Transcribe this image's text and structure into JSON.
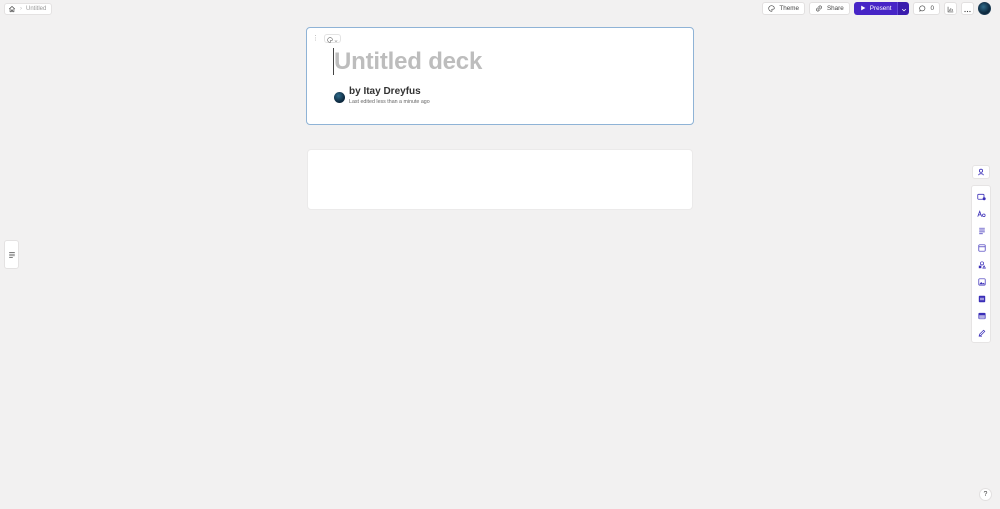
{
  "breadcrumb": {
    "doc_title": "Untitled"
  },
  "toolbar": {
    "theme_label": "Theme",
    "share_label": "Share",
    "present_label": "Present",
    "comments_count": "0"
  },
  "deck": {
    "title_placeholder": "Untitled deck",
    "author_line": "by Itay Dreyfus",
    "edited_line": "Last edited less than a minute ago"
  },
  "help": {
    "label": "?"
  },
  "colors": {
    "present_bg": "#4725c6",
    "selected_card_border": "#8fb3d6",
    "rail_icon": "#3b2fb8"
  },
  "icons": {
    "home": "home-icon",
    "theme": "palette-icon",
    "share": "share-link-icon",
    "present": "play-icon",
    "comment": "comment-icon",
    "analytics": "chart-icon",
    "more": "more-horizontal-icon",
    "card_outline": "outline-icon",
    "rail": [
      "insert-card-icon",
      "text-style-icon",
      "text-block-icon",
      "layout-icon",
      "shapes-icon",
      "image-icon",
      "embed-icon",
      "table-icon",
      "edit-icon"
    ]
  }
}
